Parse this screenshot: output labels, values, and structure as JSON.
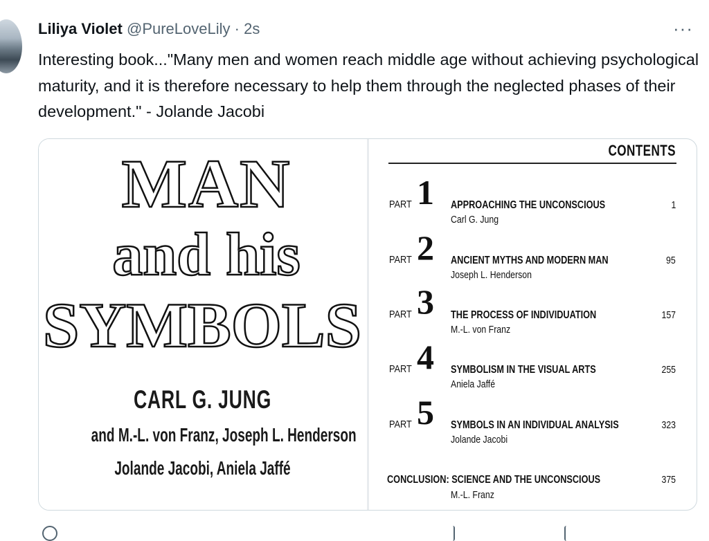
{
  "tweet": {
    "author_name": "Liliya Violet",
    "handle": "@PureLoveLily",
    "separator": "·",
    "time": "2s",
    "more_icon": "···",
    "text": "Interesting book...\"Many men and women reach middle age without achieving psychological maturity, and it is therefore necessary to help them through the neglected phases of their development.\" - Jolande Jacobi"
  },
  "book_cover": {
    "title_line1": "MAN",
    "title_line2": "and his",
    "title_line3": "SYMBOLS",
    "author_main": "CARL G. JUNG",
    "authors_line2": "and M.-L. von Franz, Joseph L. Henderson",
    "authors_line3": "Jolande Jacobi, Aniela Jaffé"
  },
  "contents": {
    "heading": "CONTENTS",
    "part_word": "PART",
    "parts": [
      {
        "num": "1",
        "title": "APPROACHING THE UNCONSCIOUS",
        "author": "Carl G. Jung",
        "page": "1"
      },
      {
        "num": "2",
        "title": "ANCIENT MYTHS AND MODERN MAN",
        "author": "Joseph L. Henderson",
        "page": "95"
      },
      {
        "num": "3",
        "title": "THE PROCESS OF INDIVIDUATION",
        "author": "M.-L. von Franz",
        "page": "157"
      },
      {
        "num": "4",
        "title": "SYMBOLISM IN THE VISUAL ARTS",
        "author": "Aniela Jaffé",
        "page": "255"
      },
      {
        "num": "5",
        "title": "SYMBOLS IN AN INDIVIDUAL ANALYSIS",
        "author": "Jolande Jacobi",
        "page": "323"
      }
    ],
    "conclusion": {
      "title": "CONCLUSION: SCIENCE AND THE UNCONSCIOUS",
      "author": "M.-L. Franz",
      "page": "375"
    }
  },
  "actions": {
    "icons": [
      "reply-icon",
      "retweet-icon",
      "like-icon",
      "share-icon"
    ]
  }
}
